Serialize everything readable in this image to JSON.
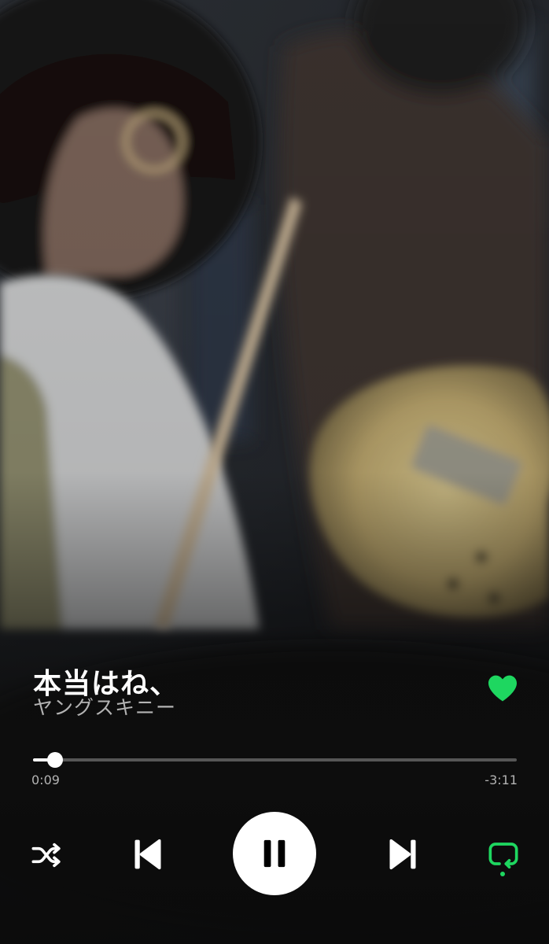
{
  "track": {
    "title": "本当はね、",
    "artist": "ヤングスキニー",
    "liked": true
  },
  "playback": {
    "elapsed": "0:09",
    "remaining": "-3:11",
    "progress_fraction": 0.045,
    "is_playing": true,
    "shuffle": false,
    "repeat": true
  },
  "icons": {
    "like": "heart-icon",
    "shuffle": "shuffle-icon",
    "previous": "skip-previous-icon",
    "play_pause": "pause-icon",
    "next": "skip-next-icon",
    "repeat": "repeat-icon"
  },
  "colors": {
    "accent": "#1ed760",
    "text_primary": "#ffffff",
    "text_secondary": "#b3b3b3"
  }
}
